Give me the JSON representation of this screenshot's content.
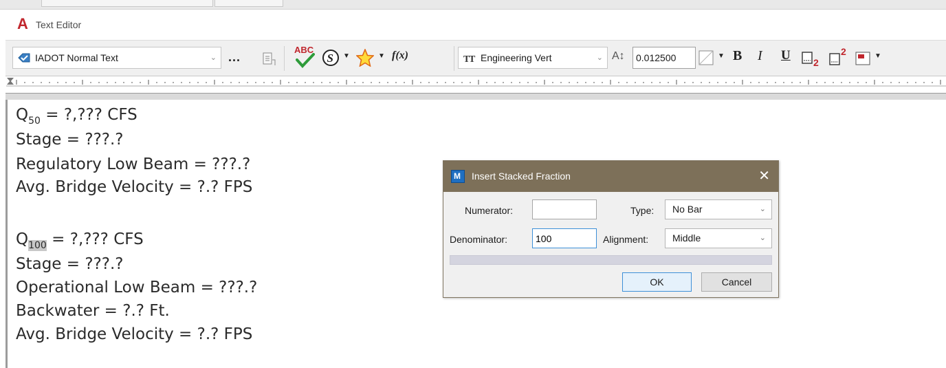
{
  "window": {
    "title": "Text Editor"
  },
  "toolbar": {
    "text_style": "IADOT Normal Text",
    "more_label": "...",
    "spell_label": "ABC",
    "function_label": "f(x)",
    "font": "Engineering Vert",
    "text_height": "0.012500",
    "bold_label": "B",
    "italic_label": "I",
    "underline_label": "U",
    "subscript_label": "2",
    "superscript_label": "2"
  },
  "editor": {
    "lines": [
      {
        "pre": "Q",
        "sub": "50",
        "post": " = ?,??? CFS"
      },
      {
        "text": "Stage = ???.?"
      },
      {
        "text": "Regulatory Low Beam = ???.?"
      },
      {
        "text": "Avg. Bridge Velocity = ?.? FPS"
      },
      {
        "pre": "Q",
        "sub": "100",
        "post": " = ?,??? CFS"
      },
      {
        "text": "Stage = ???.?"
      },
      {
        "text": "Operational Low Beam = ???.?"
      },
      {
        "text": "Backwater = ?.? Ft."
      },
      {
        "text": "Avg. Bridge Velocity = ?.? FPS"
      }
    ]
  },
  "dialog": {
    "title": "Insert Stacked Fraction",
    "numerator_label": "Numerator:",
    "numerator_value": "",
    "denominator_label": "Denominator:",
    "denominator_value": "100",
    "type_label": "Type:",
    "type_value": "No Bar",
    "alignment_label": "Alignment:",
    "alignment_value": "Middle",
    "ok_label": "OK",
    "cancel_label": "Cancel"
  },
  "colors": {
    "app_icon": "#c1272d",
    "dialog_title_bar": "#7d7059",
    "focus_border": "#3c8fd8"
  }
}
